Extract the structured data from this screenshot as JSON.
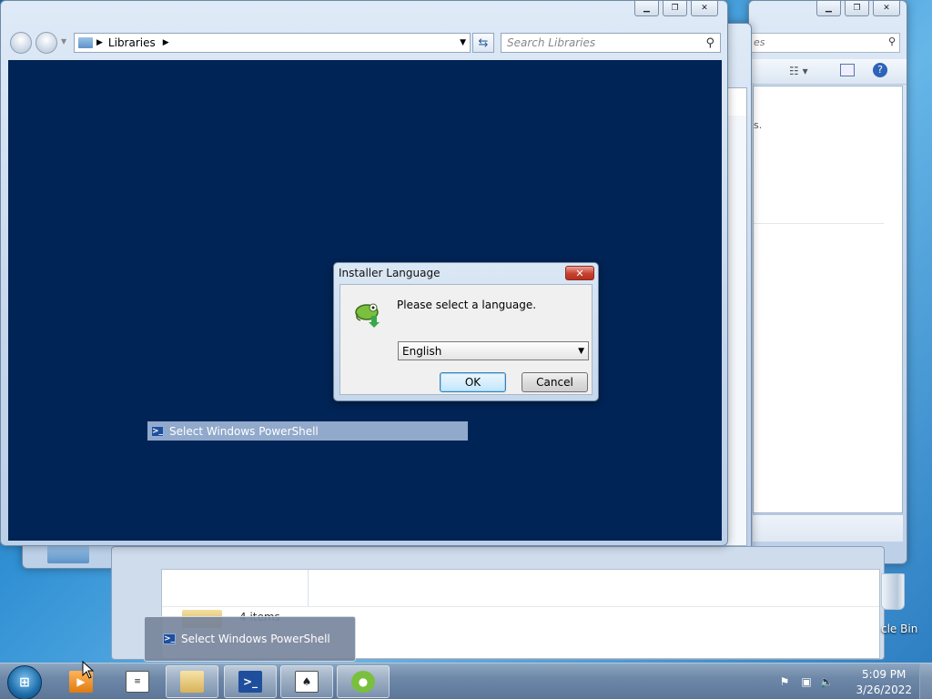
{
  "front_window": {
    "address": {
      "crumb": "Libraries"
    },
    "search": {
      "placeholder": "Search Libraries"
    }
  },
  "back_window_3": {
    "search": {
      "placeholder_fragment": "es"
    },
    "content_fragment": "s."
  },
  "lower_window": {
    "items_text": "4 items"
  },
  "console": {
    "selection_title": "Select Windows PowerShell"
  },
  "dialog": {
    "title": "Installer Language",
    "close_glyph": "✕",
    "prompt": "Please select a language.",
    "language": {
      "selected": "English"
    },
    "ok_label": "OK",
    "cancel_label": "Cancel",
    "icon": "chameleon-installer-icon"
  },
  "taskbar_thumbnail": {
    "label": "Select Windows PowerShell"
  },
  "desktop": {
    "recycle_bin_label": "cle Bin"
  },
  "taskbar": {
    "items": [
      {
        "name": "media-player",
        "icon": "media-player-icon"
      },
      {
        "name": "notepad",
        "icon": "notepad-icon"
      },
      {
        "name": "explorer",
        "icon": "folder-icon"
      },
      {
        "name": "powershell",
        "icon": "powershell-icon"
      },
      {
        "name": "solitaire",
        "icon": "cards-icon"
      },
      {
        "name": "installer",
        "icon": "chameleon-installer-icon"
      }
    ],
    "clock": {
      "time": "5:09 PM",
      "date": "3/26/2022"
    }
  },
  "colors": {
    "console_bg": "#012456",
    "selection_bar": "#91a9cb",
    "close_red": "#c7412f"
  }
}
